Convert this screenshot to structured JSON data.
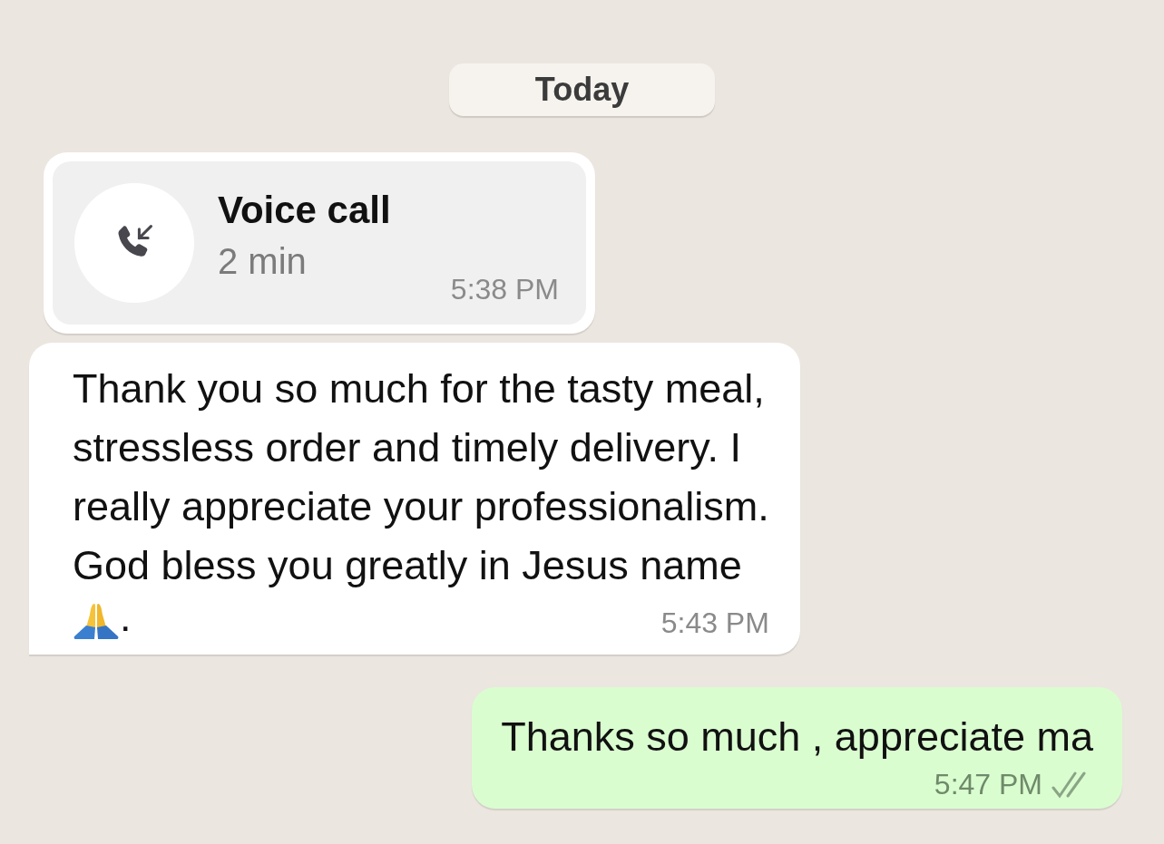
{
  "date_divider": "Today",
  "messages": [
    {
      "kind": "call",
      "outgoing": false,
      "title": "Voice call",
      "duration": "2 min",
      "time": "5:38 PM"
    },
    {
      "kind": "text",
      "outgoing": false,
      "lines": [
        "Thank you so much for the tasty meal,",
        "stressless order and timely delivery. I",
        "really appreciate your professionalism.",
        "God bless you greatly in Jesus name"
      ],
      "emoji_suffix": ".",
      "time": "5:43 PM"
    },
    {
      "kind": "text",
      "outgoing": true,
      "lines": [
        "Thanks so much , appreciate ma"
      ],
      "time": "5:47 PM",
      "read": false
    }
  ]
}
